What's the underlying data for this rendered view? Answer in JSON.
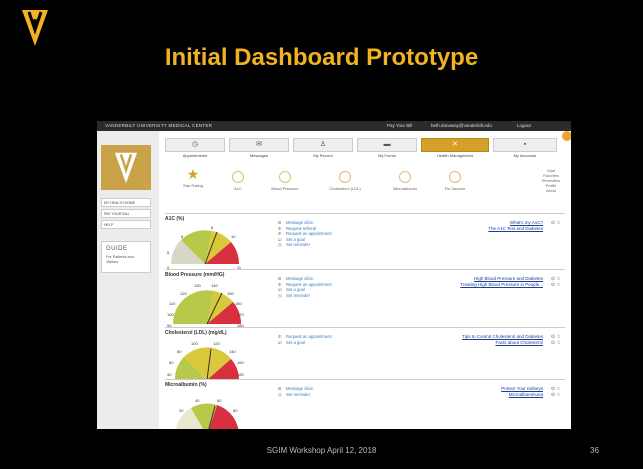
{
  "slide": {
    "title": "Initial Dashboard Prototype",
    "footer": "SGIM Workshop April 12, 2018",
    "page_number": "36",
    "accent_color": "#f0b323"
  },
  "topbar": {
    "org": "VANDERBILT UNIVERSITY MEDICAL CENTER",
    "pay_bill": "Pay Your Bill",
    "email": "beth.dunaway@vanderbilt.edu",
    "logout": "Logout"
  },
  "sidebar": {
    "items": [
      "MY HEALTH HOME",
      "PAY YOUR BILL",
      "HELP"
    ],
    "guide_title": "GUIDE",
    "guide_sub": "For Patients and Visitors"
  },
  "tabs": [
    {
      "label": "Appointments",
      "icon": "◷"
    },
    {
      "label": "Messages",
      "icon": "✉"
    },
    {
      "label": "My Record",
      "icon": "♙"
    },
    {
      "label": "My Forms",
      "icon": "▬"
    },
    {
      "label": "Health Management",
      "icon": "✕"
    },
    {
      "label": "My Accounts",
      "icon": "▪"
    }
  ],
  "goals": [
    "Star Rating",
    "A1C",
    "Blood Pressure",
    "Cholesterol (LDL)",
    "Microalbumin",
    "Flu Vaccine"
  ],
  "goal_links": [
    "Goal",
    "Favorites",
    "Reminders",
    "Profile",
    "About"
  ],
  "panels": {
    "a1c": {
      "title": "A1C (%)",
      "gauge_labels": [
        "6",
        "8",
        "10",
        "5",
        "11",
        "0"
      ],
      "actions": [
        "Message clinic",
        "Request referral",
        "Request an appointment",
        "Set a goal",
        "Set reminder"
      ],
      "links": [
        "What's my A1C?",
        "The A1C Test and Diabetes"
      ]
    },
    "bp": {
      "title": "Blood Pressure (mm/HG)",
      "gauge_labels": [
        "130",
        "140",
        "120",
        "150",
        "110",
        "160",
        "170",
        "100",
        "90",
        "180"
      ],
      "actions": [
        "Message clinic",
        "Request an appointment",
        "Set a goal",
        "Set reminder"
      ],
      "links": [
        "High Blood Pressure and Diabetes",
        "Treating High Blood Pressure in People..."
      ]
    },
    "chol": {
      "title": "Cholesterol (LDL) (mg/dL)",
      "gauge_labels": [
        "100",
        "120",
        "80",
        "140",
        "60",
        "160",
        "40",
        "180"
      ],
      "actions": [
        "Request an appointment",
        "Set a goal"
      ],
      "links": [
        "Tips to Control Cholesterol and Diabetes",
        "Facts about Cholesterol"
      ]
    },
    "micro": {
      "title": "Microalbumin (%)",
      "gauge_labels": [
        "40",
        "60",
        "20",
        "80"
      ],
      "actions": [
        "Message clinic",
        "Set reminder"
      ],
      "links": [
        "Protect Your Kidneys",
        "Microalbuminuria"
      ]
    }
  }
}
